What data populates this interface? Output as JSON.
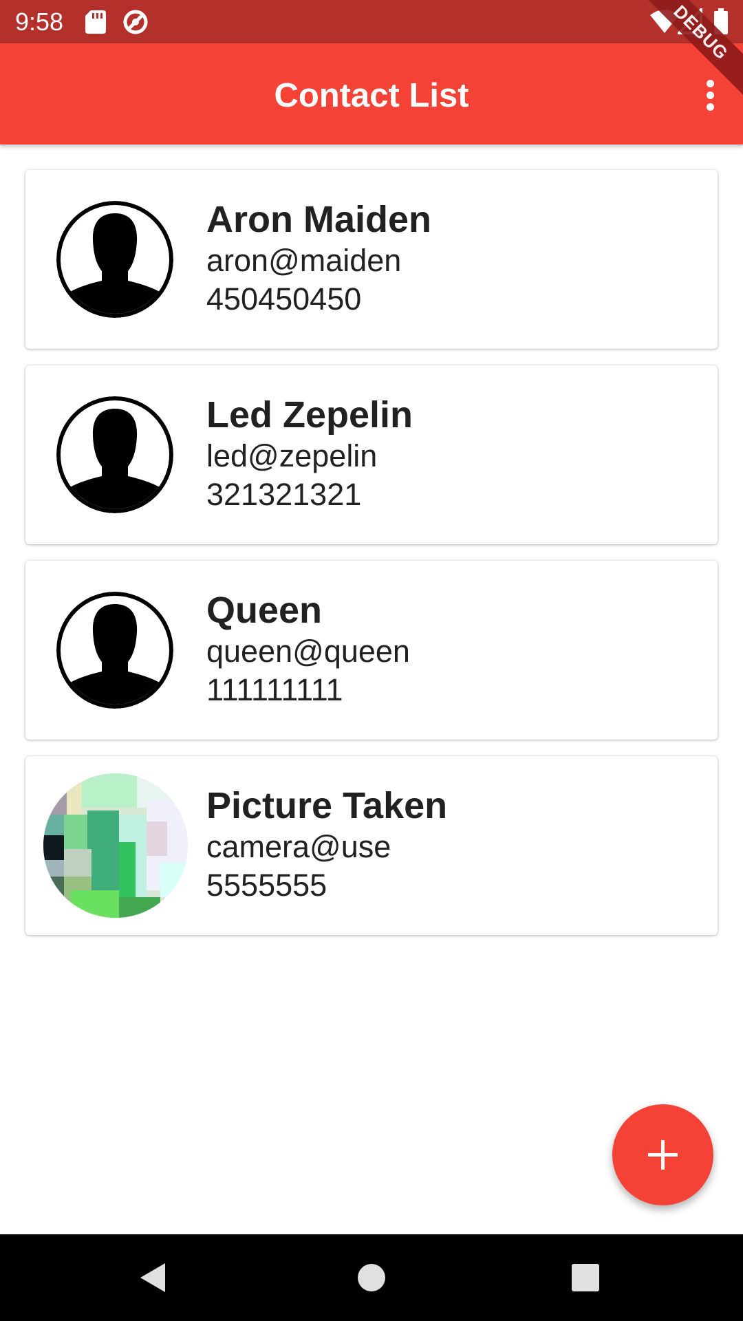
{
  "status_bar": {
    "time": "9:58",
    "icons": [
      "sd-card-icon",
      "sync-icon",
      "wifi-icon",
      "signal-icon",
      "battery-icon"
    ],
    "background": "#b3302b"
  },
  "debug_banner": "DEBUG",
  "app_bar": {
    "title": "Contact List",
    "background": "#f44336",
    "menu_icon": "more-vert-icon"
  },
  "contacts": [
    {
      "name": "Aron Maiden",
      "email": "aron@maiden",
      "phone": "450450450",
      "avatar": "default-person-icon"
    },
    {
      "name": "Led Zepelin",
      "email": "led@zepelin",
      "phone": "321321321",
      "avatar": "default-person-icon"
    },
    {
      "name": "Queen",
      "email": "queen@queen",
      "phone": "111111111",
      "avatar": "default-person-icon"
    },
    {
      "name": "Picture Taken",
      "email": "camera@use",
      "phone": "5555555",
      "avatar": "photo"
    }
  ],
  "fab": {
    "icon": "plus-icon",
    "color": "#f44336"
  },
  "nav_bar": {
    "buttons": [
      "back-icon",
      "home-icon",
      "recents-icon"
    ]
  }
}
